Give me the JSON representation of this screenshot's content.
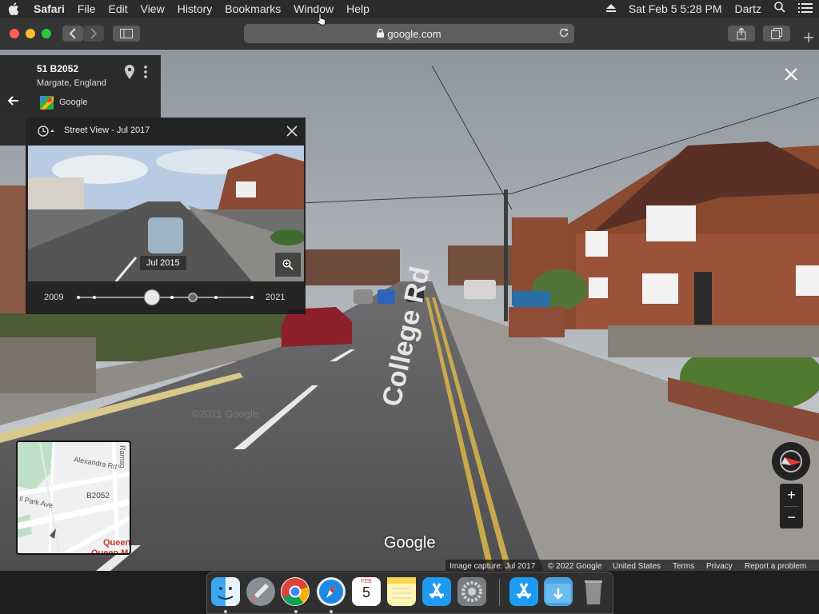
{
  "menubar": {
    "app": "Safari",
    "items": [
      "File",
      "Edit",
      "View",
      "History",
      "Bookmarks",
      "Window",
      "Help"
    ],
    "clock": "Sat Feb 5  5:28 PM",
    "user": "Dartz"
  },
  "toolbar": {
    "url": "google.com"
  },
  "place": {
    "title": "51 B2052",
    "subtitle": "Margate, England",
    "provider": "Google"
  },
  "timeline": {
    "header": "Street View - Jul 2017",
    "thumb_label": "Jul 2015",
    "start_year": "2009",
    "end_year": "2021"
  },
  "streetview": {
    "road_label": "College Rd",
    "watermark": "©2011 Google",
    "logo": "Google"
  },
  "minimap": {
    "labels": [
      "Alexandra Rd",
      "B2052",
      "Ramsg",
      "ll Park Ave",
      "Queen",
      "Queen M"
    ]
  },
  "footer": {
    "capture": "Image capture: Jul 2017",
    "copyright": "© 2022 Google",
    "country": "United States",
    "terms": "Terms",
    "privacy": "Privacy",
    "report": "Report a problem"
  },
  "controls": {
    "zoom_in": "+",
    "zoom_out": "−"
  },
  "dock": {
    "apps": [
      "finder-icon",
      "launchpad-icon",
      "chrome-icon",
      "safari-icon",
      "calendar-icon",
      "notes-icon",
      "app-store-icon",
      "system-preferences-icon",
      "app-store-icon-2",
      "downloads-folder-icon",
      "trash-icon"
    ],
    "calendar_month": "FEB",
    "calendar_day": "5"
  }
}
